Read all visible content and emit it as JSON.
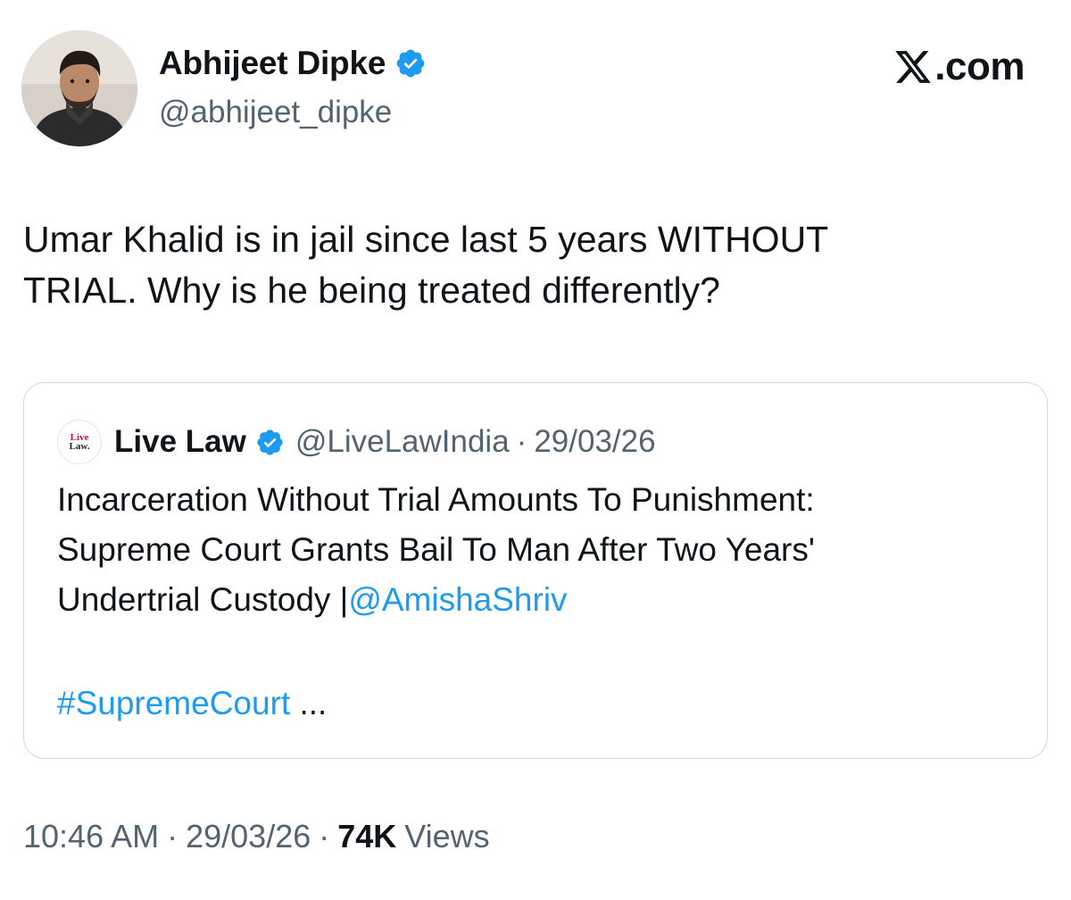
{
  "author": {
    "name": "Abhijeet Dipke",
    "handle": "@abhijeet_dipke",
    "verified": true,
    "avatar_icon": "profile-photo"
  },
  "site_logo": ".com",
  "site_logo_icon": "x-logo-icon",
  "tweet": {
    "text_line1": "Umar Khalid is in jail since last 5 years WITHOUT",
    "text_line2": "TRIAL. Why is he being treated differently?"
  },
  "quote": {
    "avatar_line1": "Live",
    "avatar_line2": "Law.",
    "name": "Live Law",
    "handle": "@LiveLawIndia",
    "separator": "·",
    "date": "29/03/26",
    "line1": "Incarceration Without Trial Amounts To Punishment:",
    "line2": "Supreme Court Grants Bail To Man After Two Years'",
    "line3_prefix": "Undertrial Custody |",
    "mention": "@AmishaShriv",
    "hashtag": "#SupremeCourt",
    "ellipsis": " ..."
  },
  "meta": {
    "time": "10:46 AM",
    "separator": "·",
    "date": "29/03/26",
    "views_count": "74K",
    "views_label": "Views"
  },
  "colors": {
    "link": "#1d9bf0",
    "verified": "#1d9bf0",
    "secondary_text": "#536471",
    "primary_text": "#0f1419",
    "card_border": "#cfd9de"
  }
}
